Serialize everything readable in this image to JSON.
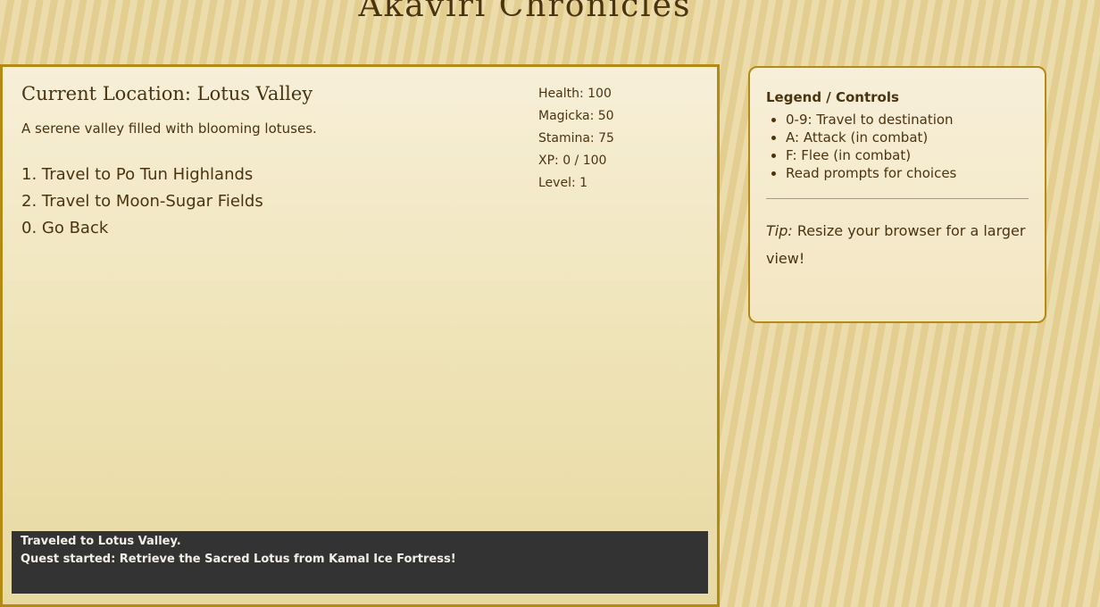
{
  "header": {
    "title": "Akaviri Chronicles"
  },
  "location": {
    "title": "Current Location: Lotus Valley",
    "description": "A serene valley filled with blooming lotuses."
  },
  "options": [
    "1. Travel to Po Tun Highlands",
    "2. Travel to Moon-Sugar Fields",
    "0. Go Back"
  ],
  "stats": {
    "health": "Health: 100",
    "magicka": "Magicka: 50",
    "stamina": "Stamina: 75",
    "xp": "XP: 0 / 100",
    "level": "Level: 1"
  },
  "log": [
    "Traveled to Lotus Valley.",
    "Quest started: Retrieve the Sacred Lotus from Kamal Ice Fortress!"
  ],
  "legend": {
    "title": "Legend / Controls",
    "items": [
      "0-9: Travel to destination",
      "A: Attack (in combat)",
      "F: Flee (in combat)",
      "Read prompts for choices"
    ],
    "tip_label": "Tip:",
    "tip_text": " Resize your browser for a larger view!"
  },
  "colors": {
    "accent": "#b38a12",
    "text": "#4a3410",
    "log_bg": "#333333"
  }
}
